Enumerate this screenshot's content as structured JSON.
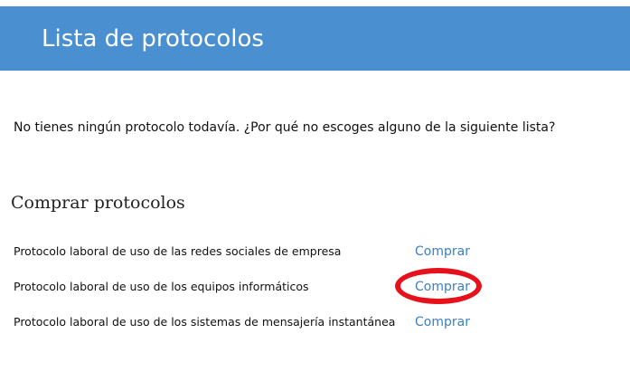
{
  "header": {
    "title": "Lista de protocolos",
    "background_color": "#4a8fcf"
  },
  "intro": {
    "text": "No tienes ningún protocolo todavía. ¿Por qué no escoges alguno de la siguiente lista?"
  },
  "purchase_section": {
    "title": "Comprar protocolos",
    "link_color": "#3b7fc4",
    "items": [
      {
        "name": "Protocolo laboral de uso de las redes sociales de empresa",
        "action_label": "Comprar"
      },
      {
        "name": "Protocolo laboral de uso de los equipos informáticos",
        "action_label": "Comprar",
        "highlighted": true
      },
      {
        "name": "Protocolo laboral de uso de los sistemas de mensajería instantánea",
        "action_label": "Comprar"
      }
    ]
  },
  "annotation": {
    "highlight_color": "#e6111b"
  }
}
